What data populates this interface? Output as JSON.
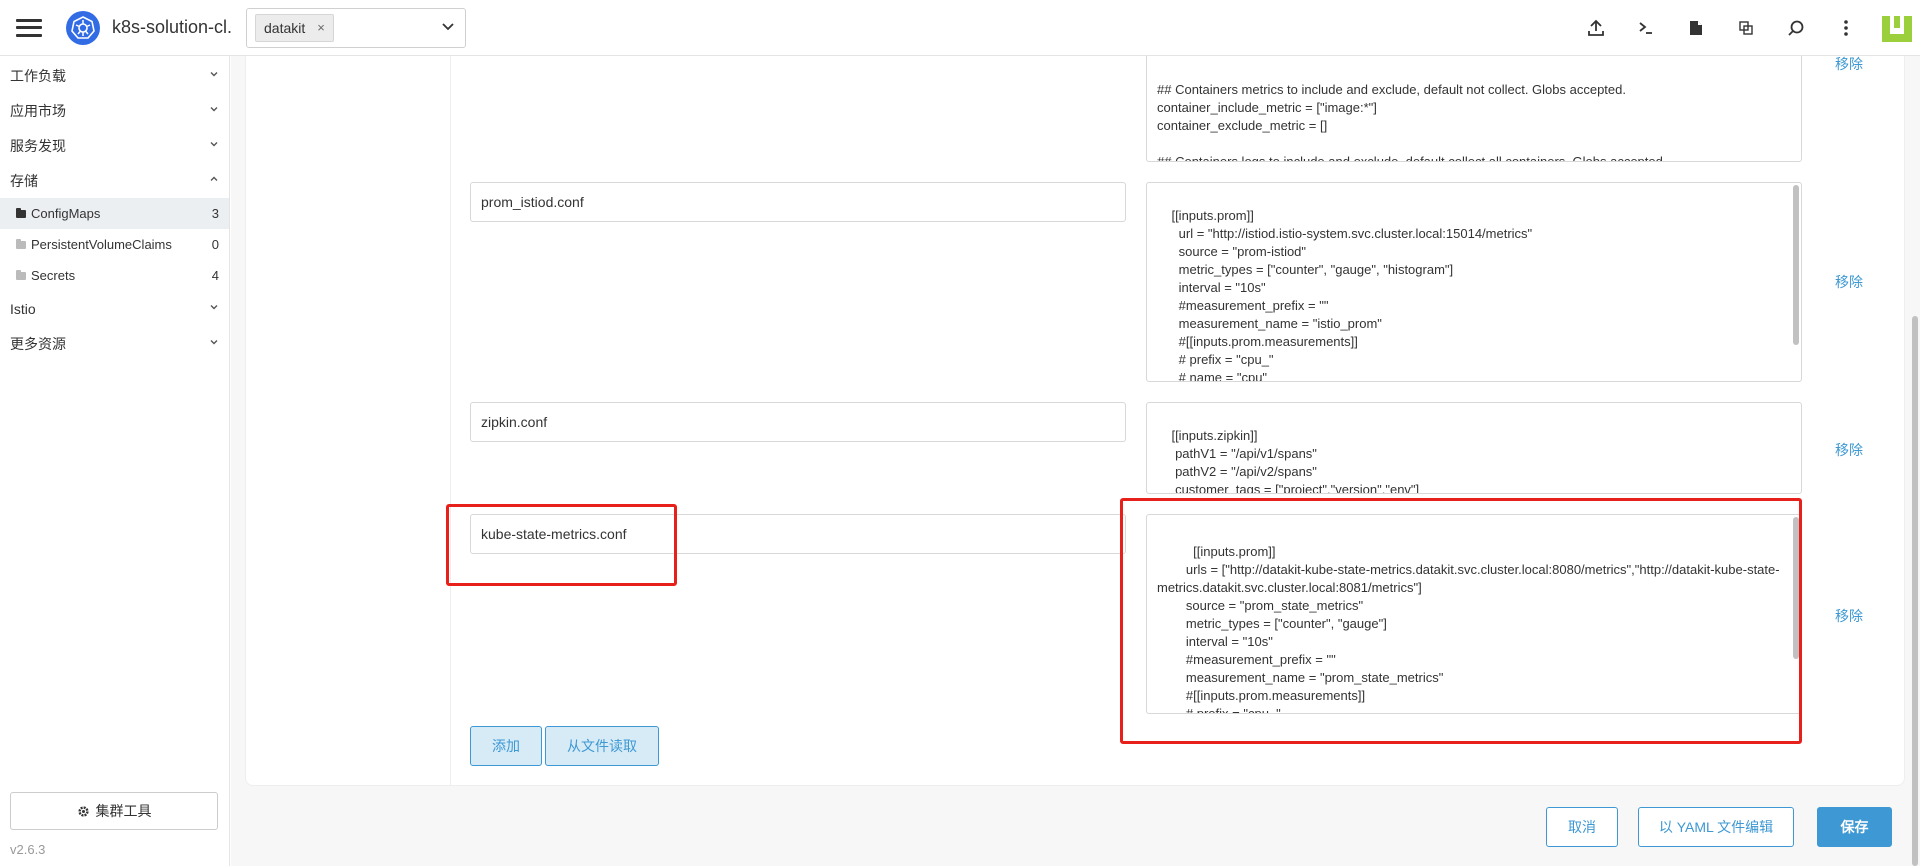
{
  "header": {
    "app_title": "k8s-solution-cl...",
    "namespace_tag": "datakit",
    "namespace_remove": "×",
    "icons": [
      "upload-icon",
      "terminal-icon",
      "file-icon",
      "copy-icon",
      "search-icon",
      "more-vertical-icon"
    ]
  },
  "sidebar": {
    "groups": [
      {
        "label": "工作负载",
        "chevron": "⌄"
      },
      {
        "label": "应用市场",
        "chevron": "⌄"
      },
      {
        "label": "服务发现",
        "chevron": "⌄"
      },
      {
        "label": "存储",
        "chevron": "⌃"
      }
    ],
    "storage_items": [
      {
        "label": "ConfigMaps",
        "count": "3"
      },
      {
        "label": "PersistentVolumeClaims",
        "count": "0"
      },
      {
        "label": "Secrets",
        "count": "4"
      }
    ],
    "groups_after": [
      {
        "label": "Istio",
        "chevron": "⌄"
      },
      {
        "label": "更多资源",
        "chevron": "⌄"
      }
    ],
    "cluster_tools": "集群工具",
    "version": "v2.6.3"
  },
  "entries": [
    {
      "key": "",
      "value": "## Containers metrics to include and exclude, default not collect. Globs accepted.\ncontainer_include_metric = [\"image:*\"]\ncontainer_exclude_metric = []\n\n## Containers logs to include and exclude, default collect all containers. Globs accepted.\ncontainer_include_log = []\ncontainer_exclude_log = [\"image:pubrepo.jiagouyun.com/datakit/logfwd*\"]",
      "remove": "移除"
    },
    {
      "key": "prom_istiod.conf",
      "value": "[[inputs.prom]]\n      url = \"http://istiod.istio-system.svc.cluster.local:15014/metrics\"\n      source = \"prom-istiod\"\n      metric_types = [\"counter\", \"gauge\", \"histogram\"]\n      interval = \"10s\"\n      #measurement_prefix = \"\"\n      measurement_name = \"istio_prom\"\n      #[[inputs.prom.measurements]]\n      # prefix = \"cpu_\"\n      # name = \"cpu\"\n      [inputs.prom.tags]",
      "remove": "移除"
    },
    {
      "key": "zipkin.conf",
      "value": "[[inputs.zipkin]]\n     pathV1 = \"/api/v1/spans\"\n     pathV2 = \"/api/v2/spans\"\n     customer_tags = [\"project\",\"version\",\"env\"]",
      "remove": "移除"
    },
    {
      "key": "kube-state-metrics.conf",
      "value": "      [[inputs.prom]]\n        urls = [\"http://datakit-kube-state-metrics.datakit.svc.cluster.local:8080/metrics\",\"http://datakit-kube-state-metrics.datakit.svc.cluster.local:8081/metrics\"]\n        source = \"prom_state_metrics\"\n        metric_types = [\"counter\", \"gauge\"]\n        interval = \"10s\"\n        #measurement_prefix = \"\"\n        measurement_name = \"prom_state_metrics\"\n        #[[inputs.prom.measurements]]\n        # prefix = \"cpu_\"\n        # name = \"cpu\"",
      "remove": "移除"
    }
  ],
  "actions": {
    "add": "添加",
    "read_from_file": "从文件读取"
  },
  "footer": {
    "cancel": "取消",
    "edit_yaml": "以 YAML 文件编辑",
    "save": "保存"
  },
  "colors": {
    "accent": "#3d98d3",
    "highlight": "#e8201c",
    "k8s_blue": "#326ce5"
  }
}
